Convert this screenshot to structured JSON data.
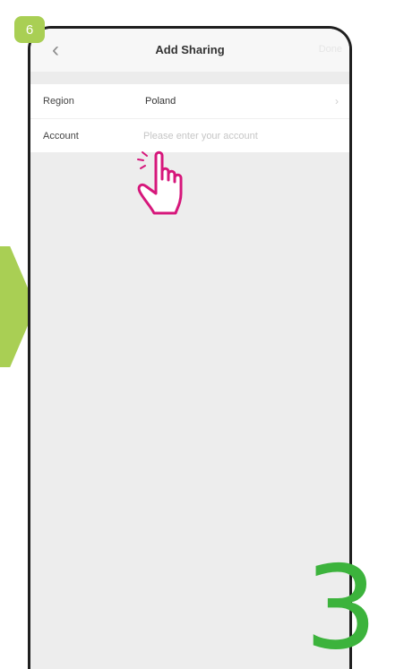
{
  "step_badge": "6",
  "nav": {
    "back_icon": "chevron-left-icon",
    "back_glyph": "‹",
    "title": "Add Sharing",
    "done_label": "Done"
  },
  "form": {
    "region_label": "Region",
    "region_value": "Poland",
    "region_icon": "chevron-right-icon",
    "region_glyph": "›",
    "account_label": "Account",
    "account_value": "",
    "account_placeholder": "Please enter your account"
  },
  "page_number": "3",
  "colors": {
    "accent_green": "#a9cf54",
    "page_number_green": "#3cb33c",
    "hand_pink": "#d6177b"
  }
}
